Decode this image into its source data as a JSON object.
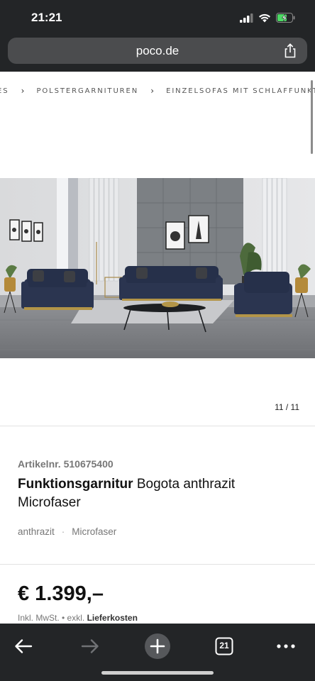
{
  "status_bar": {
    "time": "21:21"
  },
  "browser": {
    "url": "poco.de",
    "tabs_count": "21"
  },
  "breadcrumb": {
    "items": [
      "ES",
      "POLSTERGARNITUREN",
      "EINZELSOFAS MIT SCHLAFFUNKTION"
    ]
  },
  "product": {
    "image_counter": "11 / 11",
    "article_number": "Artikelnr. 510675400",
    "title_bold": "Funktionsgarnitur",
    "title_rest": " Bogota anthrazit Microfaser",
    "tags": [
      "anthrazit",
      "Microfaser"
    ],
    "tag_separator": "·",
    "price": "€ 1.399,–",
    "price_note_prefix": "Inkl. MwSt. • exkl. ",
    "price_note_link": "Lieferkosten"
  },
  "colors": {
    "chrome_bg": "#232527",
    "url_bar_bg": "#4b4c4e",
    "battery_green": "#4cd964",
    "sofa_blue": "#2b3550"
  },
  "icons": {
    "signal": "signal-icon",
    "wifi": "wifi-icon",
    "battery": "battery-charging-icon",
    "share": "share-icon",
    "back": "back-arrow-icon",
    "forward": "forward-arrow-icon",
    "new_tab": "plus-icon",
    "tabs": "tabs-icon",
    "more": "more-icon"
  }
}
